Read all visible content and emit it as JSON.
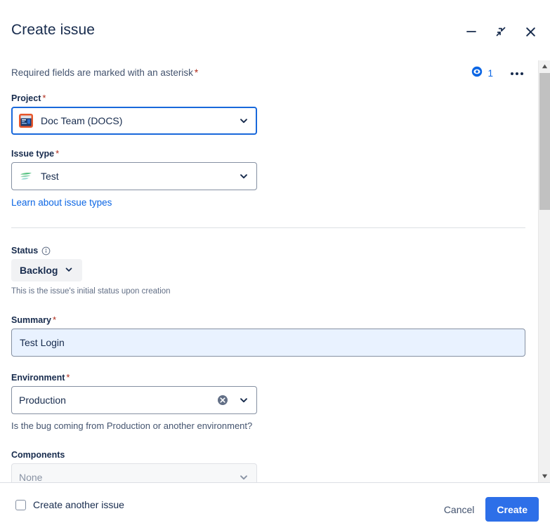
{
  "window": {
    "title": "Create issue",
    "controls": [
      {
        "name": "minimize",
        "label": "Minimize"
      },
      {
        "name": "collapse",
        "label": "Collapse"
      },
      {
        "name": "close",
        "label": "Close"
      }
    ]
  },
  "meta": {
    "required_note": "Required fields are marked with an asterisk",
    "required_asterisk": "*",
    "watch_count": "1",
    "more_actions_label": "More actions"
  },
  "fields": {
    "project": {
      "label": "Project",
      "required": "*",
      "value": "Doc Team (DOCS)",
      "icon": "project-avatar-icon",
      "focused": true
    },
    "issue_type": {
      "label": "Issue type",
      "required": "*",
      "value": "Test",
      "icon": "test-issue-type-icon",
      "learn_link": "Learn about issue types"
    },
    "status": {
      "label": "Status",
      "info_icon": "info-icon",
      "value": "Backlog",
      "helper": "This is the issue's initial status upon creation"
    },
    "summary": {
      "label": "Summary",
      "required": "*",
      "value": "Test Login",
      "placeholder": ""
    },
    "environment": {
      "label": "Environment",
      "required": "*",
      "value": "Production",
      "helper": "Is the bug coming from Production or another environment?",
      "clear_icon": "clear-icon"
    },
    "components": {
      "label": "Components",
      "value": "None"
    }
  },
  "footer": {
    "create_another_label": "Create another issue",
    "create_another_checked": false,
    "cancel_label": "Cancel",
    "create_label": "Create"
  },
  "colors": {
    "primary": "#2d6fe8",
    "link": "#0c66e4",
    "required": "#ae2a19",
    "text": "#172b4d",
    "focus_border": "#1868db",
    "summary_bg": "#e9f2ff"
  }
}
